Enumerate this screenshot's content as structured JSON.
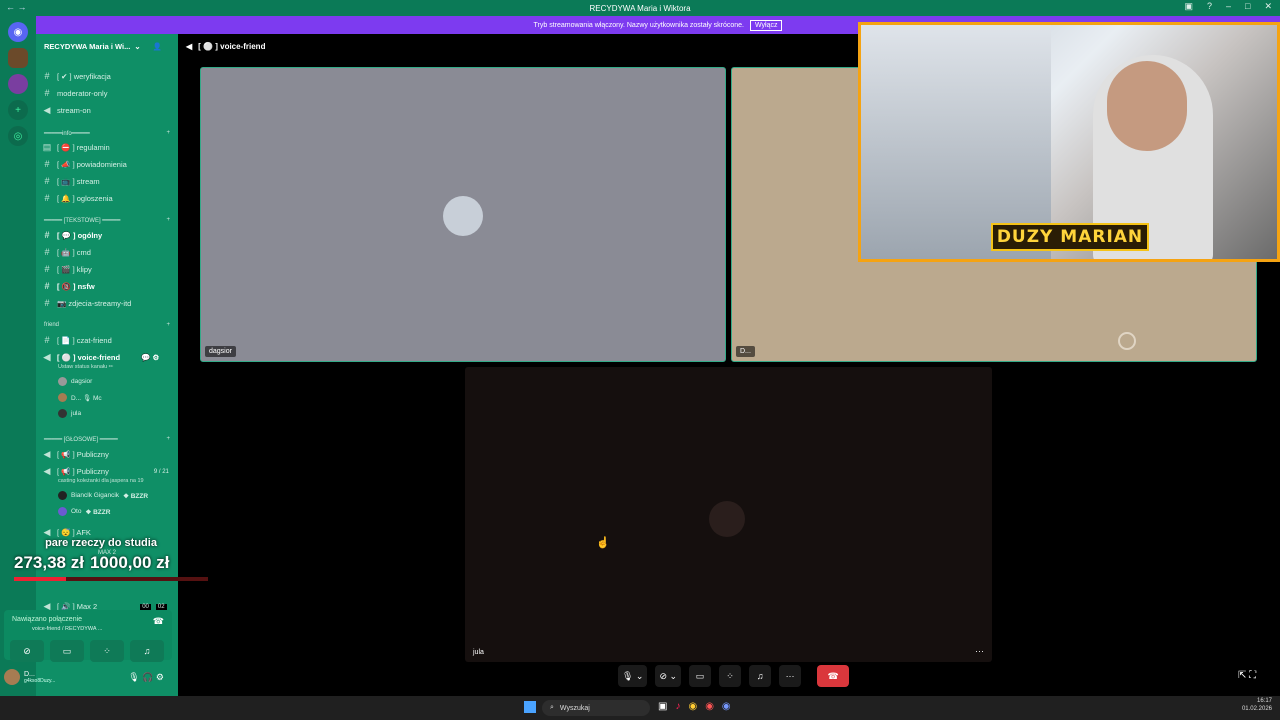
{
  "window": {
    "title": "RECYDYWA Maria i Wiktora"
  },
  "banner": {
    "text": "Tryb streamowania włączony. Nazwy użytkownika zostały skrócone.",
    "button": "Wyłącz"
  },
  "server": {
    "name": "RECYDYWA Maria i Wi..."
  },
  "channels_top": [
    {
      "label": "[ ✔ ] weryfikacja",
      "type": "text"
    },
    {
      "label": "moderator-only",
      "type": "text"
    },
    {
      "label": "stream-on",
      "type": "voice"
    }
  ],
  "cat_info": "━━━━━info━━━━━",
  "channels_info": [
    {
      "label": "[ ⛔ ] regulamin"
    },
    {
      "label": "[ 📣 ] powiadomienia"
    },
    {
      "label": "[ 📺 ] stream"
    },
    {
      "label": "[ 🔔 ] ogloszenia"
    }
  ],
  "cat_text": "━━━━━ [TEKSTOWE] ━━━━━",
  "channels_text": [
    {
      "label": "[ 💬 ] ogólny",
      "bold": true
    },
    {
      "label": "[ 🤖 ] cmd"
    },
    {
      "label": "[ 🎬 ] klipy"
    },
    {
      "label": "[ 🔞 ] nsfw",
      "bold": true
    },
    {
      "label": "📷 zdjecia-streamy-itd"
    }
  ],
  "cat_friend": "friend",
  "channels_friend": [
    {
      "label": "[ 📄 ] czat-friend"
    },
    {
      "label": "[ ⚪ ] voice-friend"
    }
  ],
  "voice_status": "Ustaw status kanału ✏",
  "voice_members": [
    "dagsior",
    "D... 🎙 Mc",
    "jula"
  ],
  "cat_voice": "━━━━━ [GŁOSOWE] ━━━━━",
  "channels_voice": [
    {
      "label": "[ 📢 ] Publiczny"
    },
    {
      "label": "[ 📢 ] Publiczny",
      "badge": "9 / 21"
    }
  ],
  "casting_text": "casting koleżanki dla jaspera na 19",
  "voice_members2": [
    {
      "name": "Bianclk Gigancik",
      "tag": "❖ BZZR"
    },
    {
      "name": "Oto",
      "tag": "❖ BZZR"
    }
  ],
  "afk": "[ 😴 ] AFK",
  "max2_cat": "MAX 2",
  "max2": "[ 🔊 ] Max 2",
  "max2_badges": [
    "00",
    "02"
  ],
  "donation": {
    "title": "pare rzeczy do studia",
    "current": "273,38 zł",
    "goal": "1000,00 zł",
    "progress": 0.27
  },
  "connection": {
    "status": "Nawiązano połączenie",
    "where": "voice-friend / RECYDYWA ..."
  },
  "user": {
    "name": "D...",
    "sub": "g4kso8Duzy..."
  },
  "header": {
    "channel": "[ ⚪ ] voice-friend"
  },
  "tiles": [
    {
      "label": "dagsior"
    },
    {
      "label": "D..."
    },
    {
      "label": "jula"
    }
  ],
  "camera_overlay": "DUZY MARIAN",
  "taskbar": {
    "search": "Wyszukaj",
    "time": "16:17",
    "date": "01.02.2026"
  }
}
